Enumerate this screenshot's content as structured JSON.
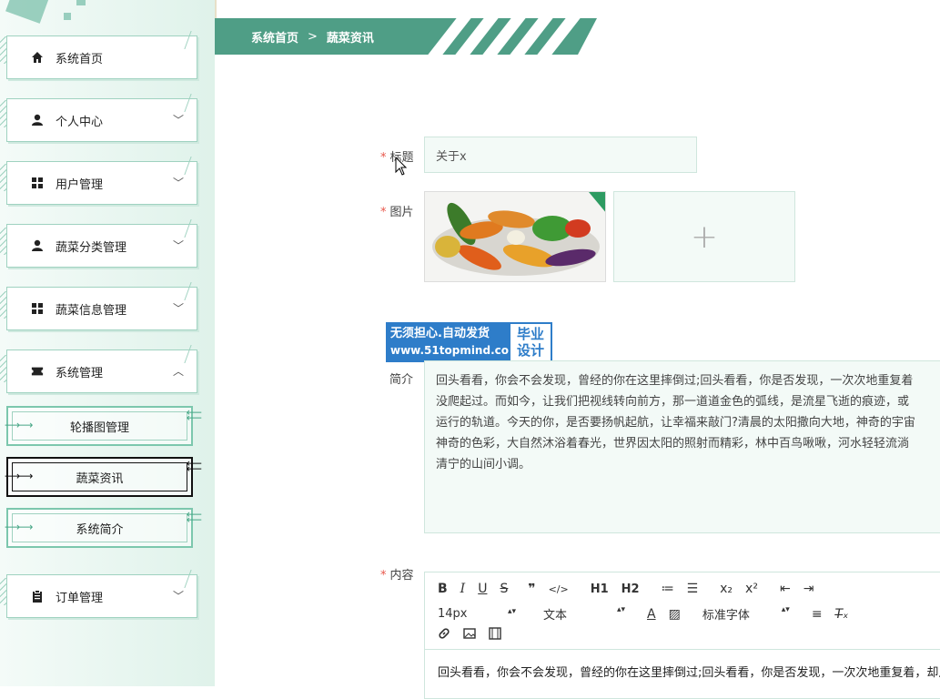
{
  "sidebar": {
    "items": [
      {
        "label": "系统首页",
        "icon": "home-icon"
      },
      {
        "label": "个人中心",
        "icon": "user-icon",
        "chevron": "﹀"
      },
      {
        "label": "用户管理",
        "icon": "grid-icon",
        "chevron": "﹀"
      },
      {
        "label": "蔬菜分类管理",
        "icon": "user-icon",
        "chevron": "﹀"
      },
      {
        "label": "蔬菜信息管理",
        "icon": "grid-icon",
        "chevron": "﹀"
      },
      {
        "label": "系统管理",
        "icon": "ticket-icon",
        "chevron": "︿"
      },
      {
        "label": "订单管理",
        "icon": "clipboard-icon",
        "chevron": "﹀"
      }
    ],
    "subitems": [
      {
        "label": "轮播图管理"
      },
      {
        "label": "蔬菜资讯"
      },
      {
        "label": "系统简介"
      }
    ]
  },
  "breadcrumb": {
    "home": "系统首页",
    "separator": ">",
    "current": "蔬菜资讯"
  },
  "form": {
    "title_label": "标题",
    "title_value": "关于x",
    "image_label": "图片",
    "upload_plus": "+",
    "desc_label": "简介",
    "desc_lines": [
      "回头看看，你会不会发现，曾经的你在这里摔倒过;回头看看，你是否发现，一次次地重复着",
      "没爬起过。而如今，让我们把视线转向前方，那一道道金色的弧线，是流星飞逝的痕迹，或",
      "运行的轨道。今天的你，是否要扬帆起航，让幸福来敲门?清晨的太阳撒向大地，神奇的宇宙",
      "神奇的色彩，大自然沐浴着春光，世界因太阳的照射而精彩，林中百鸟啾啾，河水轻轻流淌",
      "清宁的山间小调。"
    ],
    "content_label": "内容",
    "required_mark": "*"
  },
  "watermark": {
    "line1": "无须担心.自动发货",
    "line2": "www.51topmind.com",
    "badge1": "毕业",
    "badge2": "设计"
  },
  "editor": {
    "toolbar1": [
      "B",
      "I",
      "U",
      "S",
      "❞",
      "</>",
      "H1",
      "H2",
      "≔",
      "☰",
      "x₂",
      "x²",
      "⇤",
      "⇥"
    ],
    "font_size": "14px",
    "block_type": "文本",
    "font_family": "标准字体",
    "text": "回头看看，你会不会发现，曾经的你在这里摔倒过;回头看看，你是否发现，一次次地重复着，却从"
  }
}
